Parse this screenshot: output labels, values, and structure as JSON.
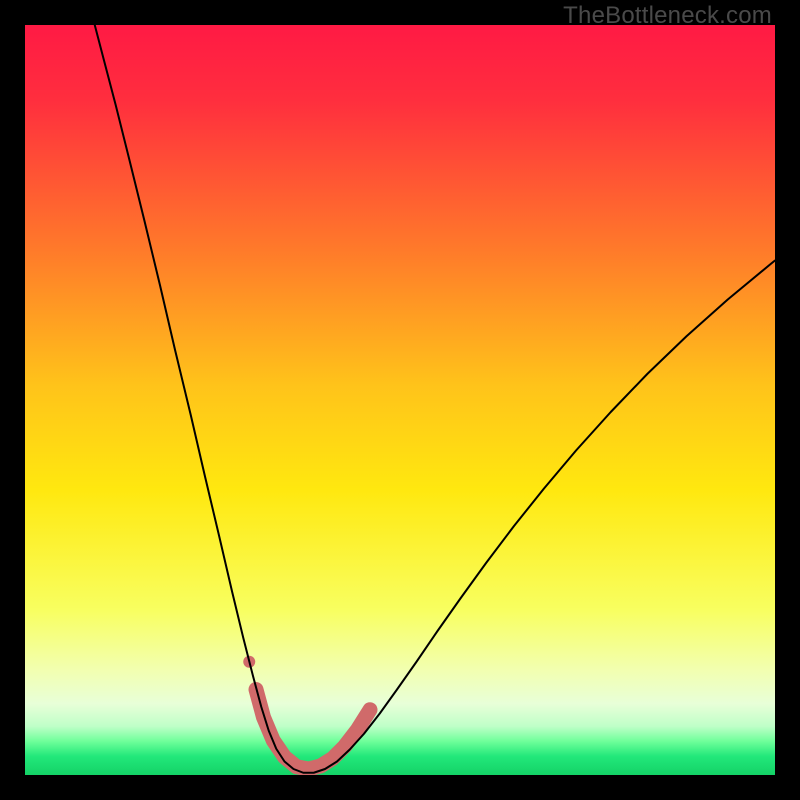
{
  "watermark": "TheBottleneck.com",
  "chart_data": {
    "type": "line",
    "title": "",
    "xlabel": "",
    "ylabel": "",
    "xlim": [
      0,
      100
    ],
    "ylim": [
      0,
      100
    ],
    "background_gradient": {
      "stops": [
        {
          "offset": 0.0,
          "color": "#ff1a44"
        },
        {
          "offset": 0.1,
          "color": "#ff2e3e"
        },
        {
          "offset": 0.3,
          "color": "#ff7a2a"
        },
        {
          "offset": 0.48,
          "color": "#ffc31a"
        },
        {
          "offset": 0.62,
          "color": "#ffe80f"
        },
        {
          "offset": 0.78,
          "color": "#f8ff60"
        },
        {
          "offset": 0.86,
          "color": "#f2ffb0"
        },
        {
          "offset": 0.905,
          "color": "#e8ffd8"
        },
        {
          "offset": 0.935,
          "color": "#bfffc8"
        },
        {
          "offset": 0.955,
          "color": "#6fff9a"
        },
        {
          "offset": 0.975,
          "color": "#22e87a"
        },
        {
          "offset": 1.0,
          "color": "#14d267"
        }
      ]
    },
    "series": [
      {
        "name": "bottleneck-curve",
        "color": "#000000",
        "width": 2.0,
        "points": [
          {
            "x": 9.3,
            "y": 100.0
          },
          {
            "x": 10.5,
            "y": 95.4
          },
          {
            "x": 12.1,
            "y": 89.3
          },
          {
            "x": 13.9,
            "y": 82.1
          },
          {
            "x": 15.9,
            "y": 74.0
          },
          {
            "x": 18.0,
            "y": 65.3
          },
          {
            "x": 20.0,
            "y": 56.7
          },
          {
            "x": 22.1,
            "y": 48.0
          },
          {
            "x": 24.0,
            "y": 39.8
          },
          {
            "x": 25.9,
            "y": 31.8
          },
          {
            "x": 27.6,
            "y": 24.5
          },
          {
            "x": 29.1,
            "y": 18.3
          },
          {
            "x": 30.4,
            "y": 13.2
          },
          {
            "x": 31.5,
            "y": 9.1
          },
          {
            "x": 32.5,
            "y": 5.9
          },
          {
            "x": 33.5,
            "y": 3.5
          },
          {
            "x": 34.6,
            "y": 1.8
          },
          {
            "x": 35.8,
            "y": 0.8
          },
          {
            "x": 37.1,
            "y": 0.3
          },
          {
            "x": 38.5,
            "y": 0.3
          },
          {
            "x": 40.0,
            "y": 0.8
          },
          {
            "x": 41.6,
            "y": 1.8
          },
          {
            "x": 43.3,
            "y": 3.4
          },
          {
            "x": 45.2,
            "y": 5.5
          },
          {
            "x": 47.3,
            "y": 8.2
          },
          {
            "x": 49.6,
            "y": 11.4
          },
          {
            "x": 52.2,
            "y": 15.1
          },
          {
            "x": 55.0,
            "y": 19.2
          },
          {
            "x": 58.1,
            "y": 23.6
          },
          {
            "x": 61.5,
            "y": 28.3
          },
          {
            "x": 65.2,
            "y": 33.2
          },
          {
            "x": 69.2,
            "y": 38.2
          },
          {
            "x": 73.5,
            "y": 43.3
          },
          {
            "x": 78.1,
            "y": 48.4
          },
          {
            "x": 83.0,
            "y": 53.5
          },
          {
            "x": 88.2,
            "y": 58.5
          },
          {
            "x": 93.7,
            "y": 63.4
          },
          {
            "x": 99.5,
            "y": 68.2
          },
          {
            "x": 100.0,
            "y": 68.6
          }
        ]
      },
      {
        "name": "optimal-band-highlight",
        "color": "#d06a6a",
        "width": 15,
        "cap": "round",
        "points": [
          {
            "x": 30.8,
            "y": 11.4
          },
          {
            "x": 31.8,
            "y": 7.7
          },
          {
            "x": 33.1,
            "y": 4.6
          },
          {
            "x": 34.6,
            "y": 2.4
          },
          {
            "x": 36.2,
            "y": 1.1
          },
          {
            "x": 37.8,
            "y": 0.8
          },
          {
            "x": 39.4,
            "y": 1.2
          },
          {
            "x": 41.0,
            "y": 2.2
          },
          {
            "x": 42.6,
            "y": 3.8
          },
          {
            "x": 44.3,
            "y": 6.0
          },
          {
            "x": 46.0,
            "y": 8.7
          }
        ]
      },
      {
        "name": "marker-dot",
        "type": "scatter",
        "color": "#d06a6a",
        "radius": 6,
        "points": [
          {
            "x": 29.9,
            "y": 15.1
          }
        ]
      }
    ]
  }
}
